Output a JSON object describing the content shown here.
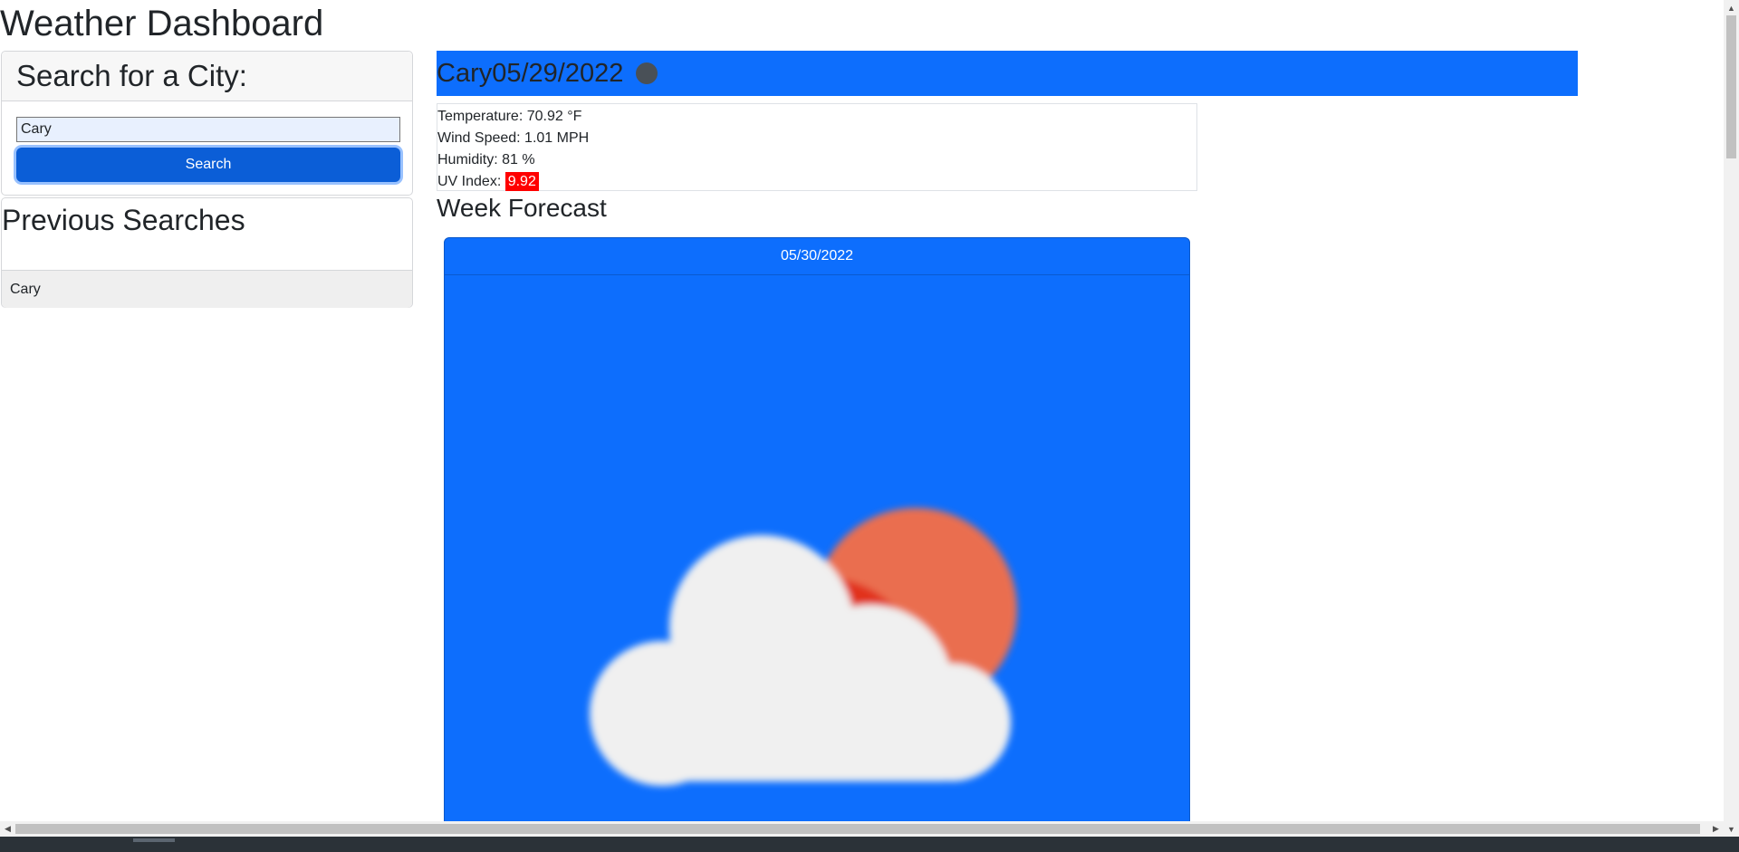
{
  "app": {
    "title": "Weather Dashboard"
  },
  "search": {
    "header": "Search for a City:",
    "input_value": "Cary",
    "button_label": "Search"
  },
  "previous": {
    "title": "Previous Searches",
    "items": [
      "Cary"
    ]
  },
  "current": {
    "heading": "Cary05/29/2022",
    "icon": "weather-status-icon",
    "temperature": "Temperature: 70.92 °F",
    "wind": "Wind Speed: 1.01 MPH",
    "humidity": "Humidity: 81 %",
    "uv_label": "UV Index: ",
    "uv_value": "9.92",
    "uv_color": "#ff0000"
  },
  "forecast": {
    "title": "Week Forecast",
    "days": [
      {
        "date": "05/30/2022",
        "icon": "partly-cloudy-icon"
      }
    ]
  },
  "colors": {
    "accent": "#0d6efd",
    "button": "#0b5ed7",
    "uv_high": "#ff0000"
  }
}
